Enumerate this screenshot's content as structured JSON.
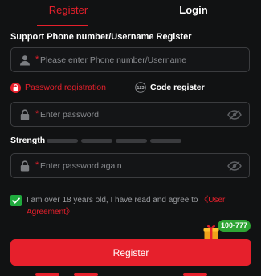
{
  "tabs": {
    "register": "Register",
    "login": "Login",
    "active": "register"
  },
  "section_title": "Support Phone number/Username Register",
  "username": {
    "placeholder": "Please enter Phone number/Username",
    "required_mark": "*",
    "icon": "user-icon"
  },
  "modes": {
    "password": "Password registration",
    "code": "Code register",
    "selected": "password"
  },
  "password": {
    "placeholder": "Enter password",
    "required_mark": "*",
    "icon": "lock-icon"
  },
  "strength": {
    "label": "Strength",
    "level": 0,
    "segments": 4
  },
  "confirm": {
    "placeholder": "Enter password again",
    "required_mark": "*",
    "icon": "lock-icon"
  },
  "agreement": {
    "checked": true,
    "text": "I am over 18 years old, I have read and agree to ",
    "link": "《User Agreement》"
  },
  "promo": {
    "badge": "100-777",
    "icon": "gift-icon"
  },
  "submit": {
    "label": "Register"
  },
  "colors": {
    "accent": "#e6202c",
    "success": "#1faa3d",
    "background": "#111213",
    "muted": "#8a8c90"
  }
}
